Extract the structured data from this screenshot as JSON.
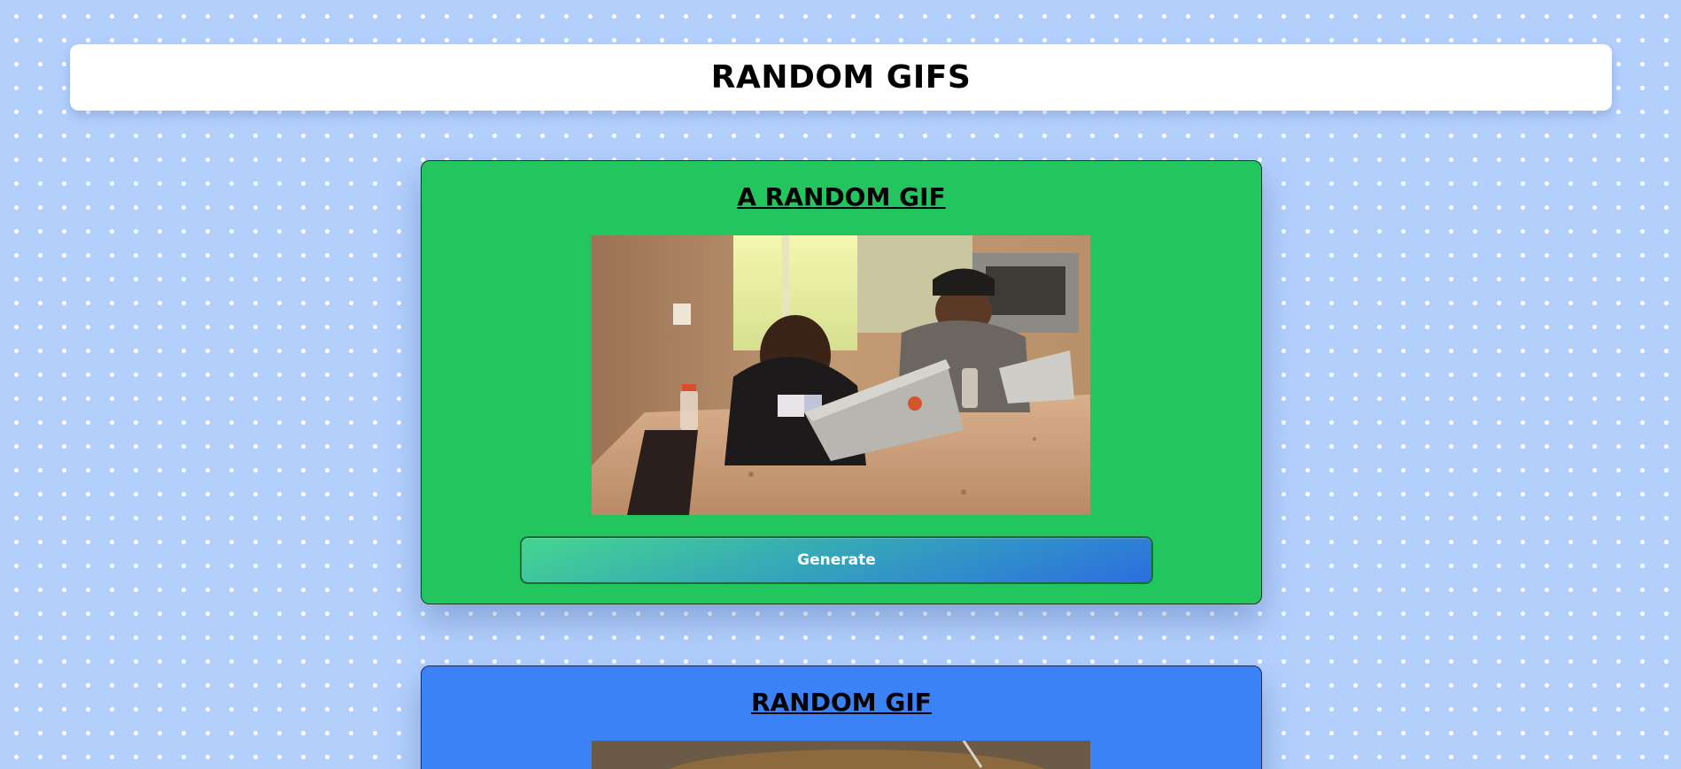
{
  "header": {
    "title": "RANDOM GIFS"
  },
  "cards": [
    {
      "title": "A RANDOM GIF",
      "button_label": "Generate",
      "color": "#23c55e"
    },
    {
      "title": "RANDOM GIF",
      "color": "#3b82f6"
    }
  ],
  "colors": {
    "page_background": "#b3d0fd",
    "dot_pattern": "#ffffff",
    "button_gradient_start": "#45d68f",
    "button_gradient_end": "#2b6ee0"
  }
}
